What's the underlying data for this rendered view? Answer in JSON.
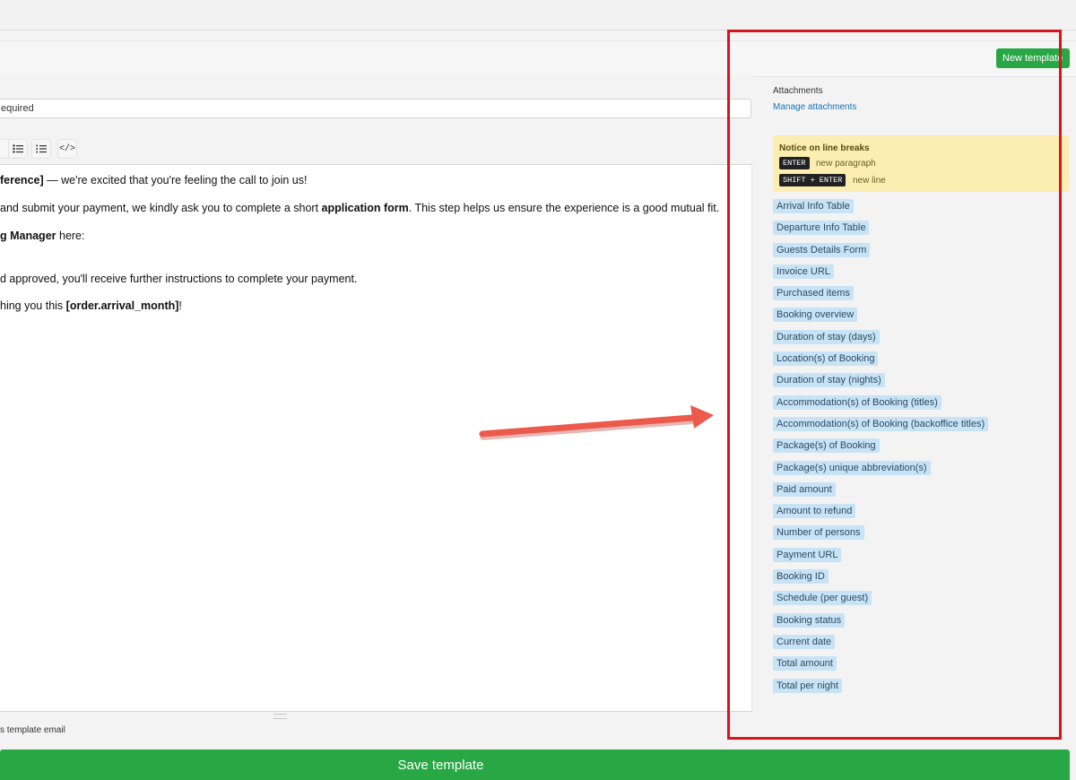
{
  "new_template_label": "New template",
  "subject": {
    "value": "equired"
  },
  "toolbar": {
    "code_label": "</>"
  },
  "editor": {
    "line1": {
      "strong": "ference]",
      "text": " — we're excited that you're feeling the call to join us!"
    },
    "line2": {
      "pre": "and submit your payment, we kindly ask you to complete a short ",
      "strong": "application form",
      "post": ". This step helps us ensure the experience is a good mutual fit."
    },
    "line3": {
      "strong": "g Manager",
      "post": " here:"
    },
    "line4": {
      "text": "d approved, you'll receive further instructions to complete your payment."
    },
    "line5": {
      "pre": "hing you this ",
      "strong": "[order.arrival_month]",
      "post": "!"
    }
  },
  "checkbox_label": "s template email",
  "save_label": "Save template",
  "sidebar": {
    "attachments_title": "Attachments",
    "manage_attachments": "Manage attachments",
    "notice": {
      "title": "Notice on line breaks",
      "key1": "ENTER",
      "key1_desc": "new paragraph",
      "key2": "SHIFT + ENTER",
      "key2_desc": "new line"
    },
    "tags": [
      "Arrival Info Table",
      "Departure Info Table",
      "Guests Details Form",
      "Invoice URL",
      "Purchased items",
      "Booking overview",
      "Duration of stay (days)",
      "Location(s) of Booking",
      "Duration of stay (nights)",
      "Accommodation(s) of Booking (titles)",
      "Accommodation(s) of Booking (backoffice titles)",
      "Package(s) of Booking",
      "Package(s) unique abbreviation(s)",
      "Paid amount",
      "Amount to refund",
      "Number of persons",
      "Payment URL",
      "Booking ID",
      "Schedule (per guest)",
      "Booking status",
      "Current date",
      "Total amount",
      "Total per night"
    ]
  },
  "colors": {
    "accent_green": "#28a745",
    "highlight_red": "#d9141c",
    "tag_blue": "#c8e3f5",
    "notice_yellow": "#fbeeb0"
  }
}
